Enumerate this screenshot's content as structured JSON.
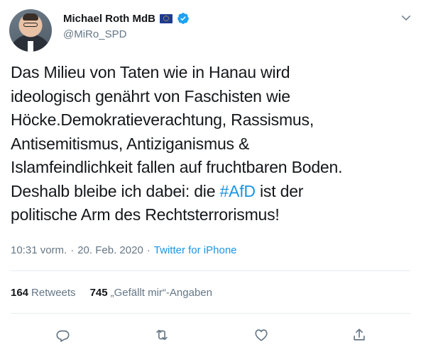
{
  "author": {
    "name": "Michael Roth MdB",
    "handle": "@MiRo_SPD"
  },
  "tweet": {
    "lines": [
      {
        "text": "Das Milieu von Taten wie in Hanau wird"
      },
      {
        "text": "ideologisch genährt von Faschisten wie"
      },
      {
        "text": "Höcke.Demokratieverachtung, Rassismus,"
      },
      {
        "text": "Antisemitismus, Antiziganismus &"
      },
      {
        "text": "Islamfeindlichkeit fallen auf fruchtbaren Boden."
      },
      {
        "pre": "Deshalb bleibe ich dabei: die ",
        "hashtag": "#AfD",
        "post": " ist der"
      },
      {
        "text": "politische Arm des Rechtsterrorismus!"
      }
    ]
  },
  "meta": {
    "time": "10:31 vorm.",
    "separator1": "·",
    "date": "20. Feb. 2020",
    "separator2": "·",
    "source": "Twitter for iPhone"
  },
  "stats": {
    "retweets_count": "164",
    "retweets_label": "Retweets",
    "likes_count": "745",
    "likes_label": "„Gefällt mir“-Angaben"
  },
  "icons": {
    "verified": "verified-badge-icon",
    "flag": "eu-flag-icon",
    "more": "chevron-down-icon",
    "reply": "reply-icon",
    "retweet": "retweet-icon",
    "like": "heart-icon",
    "share": "share-icon"
  },
  "colors": {
    "link": "#1b95e0",
    "text": "#14171a",
    "muted": "#657786",
    "divider": "#e6ecf0"
  }
}
